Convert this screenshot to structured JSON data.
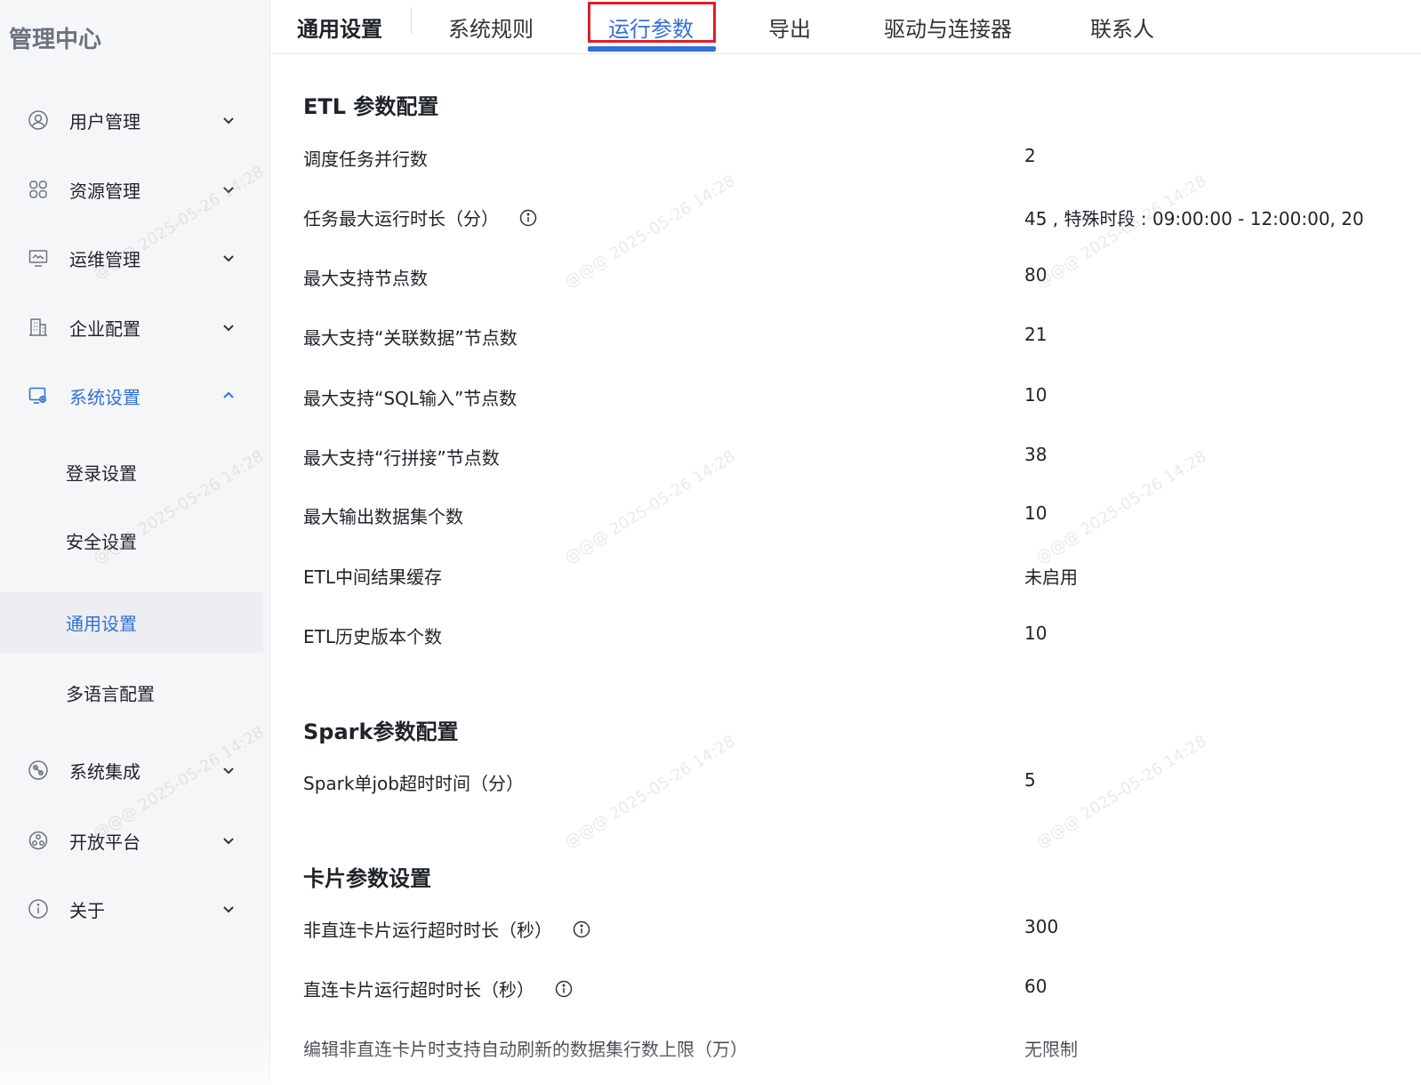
{
  "sidebar": {
    "title": "管理中心",
    "menu": [
      {
        "label": "用户管理",
        "icon": "user-icon"
      },
      {
        "label": "资源管理",
        "icon": "grid-icon"
      },
      {
        "label": "运维管理",
        "icon": "monitor-icon"
      },
      {
        "label": "企业配置",
        "icon": "building-icon"
      },
      {
        "label": "系统设置",
        "icon": "settings-icon"
      },
      {
        "label": "系统集成",
        "icon": "integration-icon"
      },
      {
        "label": "开放平台",
        "icon": "platform-icon"
      },
      {
        "label": "关于",
        "icon": "info-icon"
      }
    ],
    "submenu": [
      {
        "label": "登录设置"
      },
      {
        "label": "安全设置"
      },
      {
        "label": "通用设置"
      },
      {
        "label": "多语言配置"
      }
    ]
  },
  "tabs": {
    "page": "通用设置",
    "items": [
      "系统规则",
      "运行参数",
      "导出",
      "驱动与连接器",
      "联系人"
    ]
  },
  "sections": {
    "etl": {
      "title": "ETL 参数配置",
      "rows": [
        {
          "label": "调度任务并行数",
          "value": "2"
        },
        {
          "label": "任务最大运行时长（分）",
          "value": "45 , 特殊时段 : 09:00:00 - 12:00:00, 20"
        },
        {
          "label": "最大支持节点数",
          "value": "80"
        },
        {
          "label": "最大支持“关联数据”节点数",
          "value": "21"
        },
        {
          "label": "最大支持“SQL输入”节点数",
          "value": "10"
        },
        {
          "label": "最大支持“行拼接”节点数",
          "value": "38"
        },
        {
          "label": "最大输出数据集个数",
          "value": "10"
        },
        {
          "label": "ETL中间结果缓存",
          "value": "未启用"
        },
        {
          "label": "ETL历史版本个数",
          "value": "10"
        }
      ]
    },
    "spark": {
      "title": "Spark参数配置",
      "rows": [
        {
          "label": "Spark单job超时时间（分）",
          "value": "5"
        }
      ]
    },
    "card": {
      "title": "卡片参数设置",
      "rows": [
        {
          "label": "非直连卡片运行超时时长（秒）",
          "value": "300"
        },
        {
          "label": "直连卡片运行超时时长（秒）",
          "value": "60"
        },
        {
          "label": "编辑非直连卡片时支持自动刷新的数据集行数上限（万）",
          "value": "无限制"
        }
      ]
    }
  },
  "watermark": {
    "name": "@@@",
    "time": "2025-05-26 14:28"
  },
  "colors": {
    "accent": "#3370d6",
    "highlight_box": "#e11d2a"
  }
}
